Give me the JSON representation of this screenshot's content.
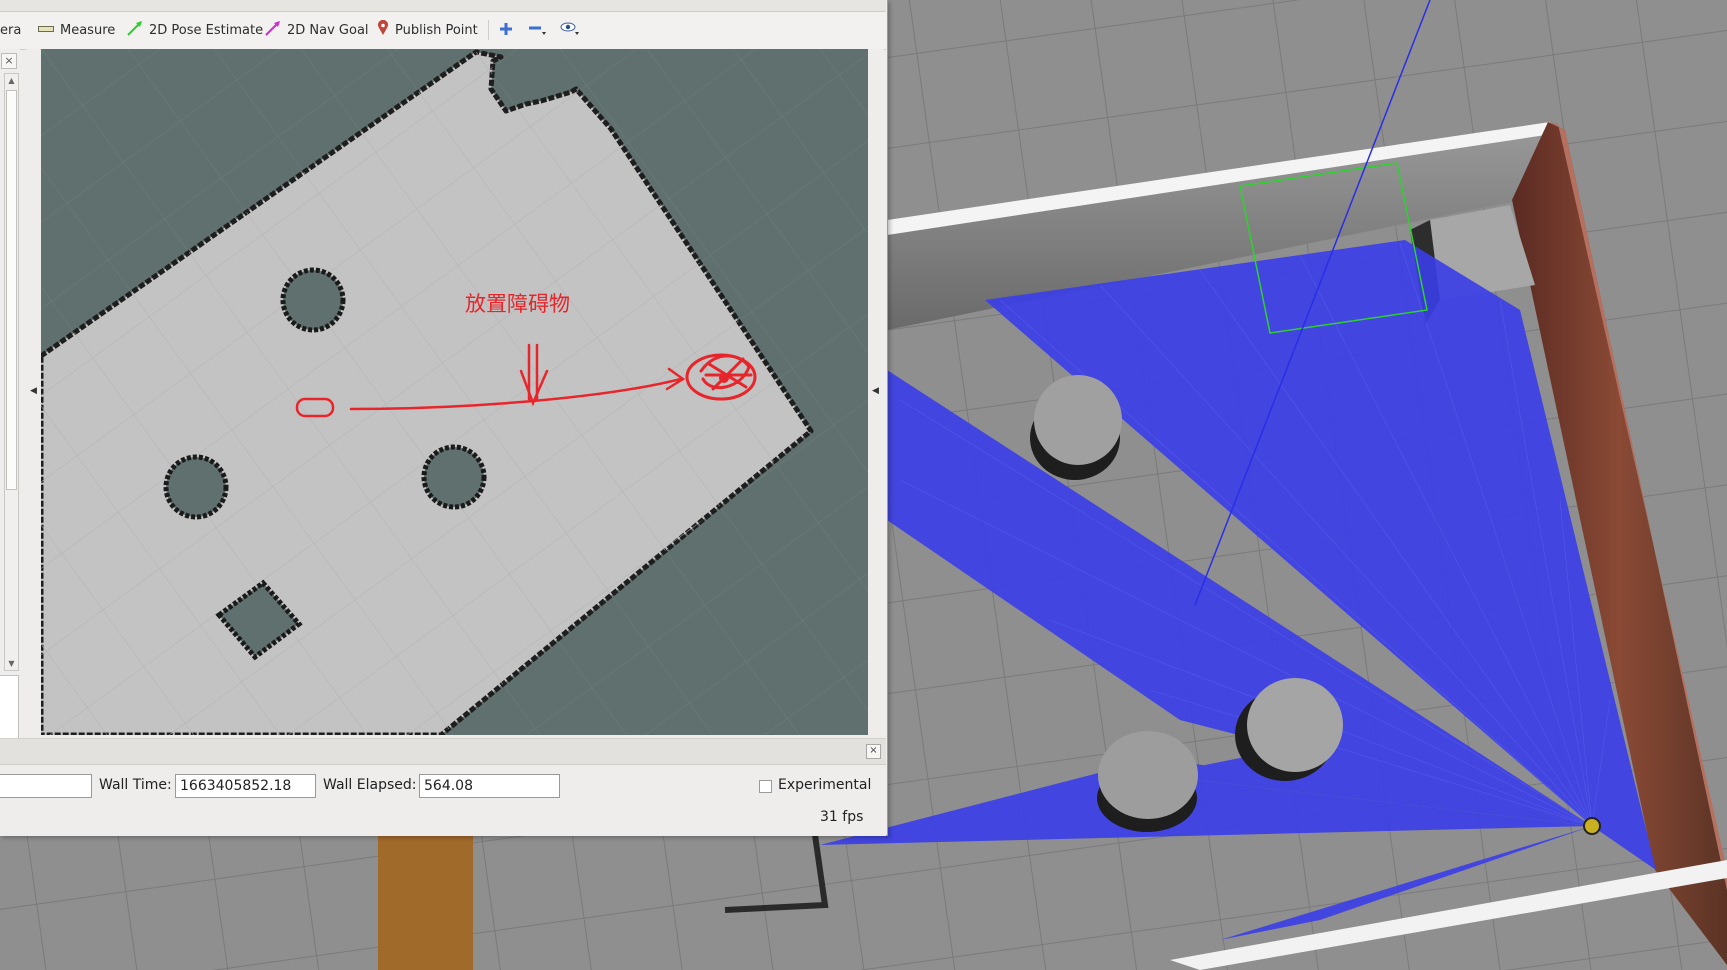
{
  "toolbar": {
    "camera_partial": "era",
    "measure": "Measure",
    "pose_estimate": "2D Pose Estimate",
    "nav_goal": "2D Nav Goal",
    "publish_point": "Publish Point",
    "icons": [
      "measure-icon",
      "pose-arrow-icon",
      "nav-arrow-icon",
      "pin-icon",
      "plus-icon",
      "minus-icon",
      "eye-icon"
    ]
  },
  "annotation": {
    "text": "放置障碍物",
    "color": "#e8252a"
  },
  "time_panel": {
    "wall_time_label": "Wall Time:",
    "wall_time_value": "1663405852.18",
    "wall_elapsed_label": "Wall Elapsed:",
    "wall_elapsed_value": "564.08",
    "experimental_label": "Experimental",
    "experimental_checked": false,
    "fps": "31 fps"
  },
  "colors": {
    "map_free": "#c3c3c3",
    "map_unknown": "#5f706e",
    "laser": "#2a2ee6",
    "footprint": "#22cc22"
  }
}
